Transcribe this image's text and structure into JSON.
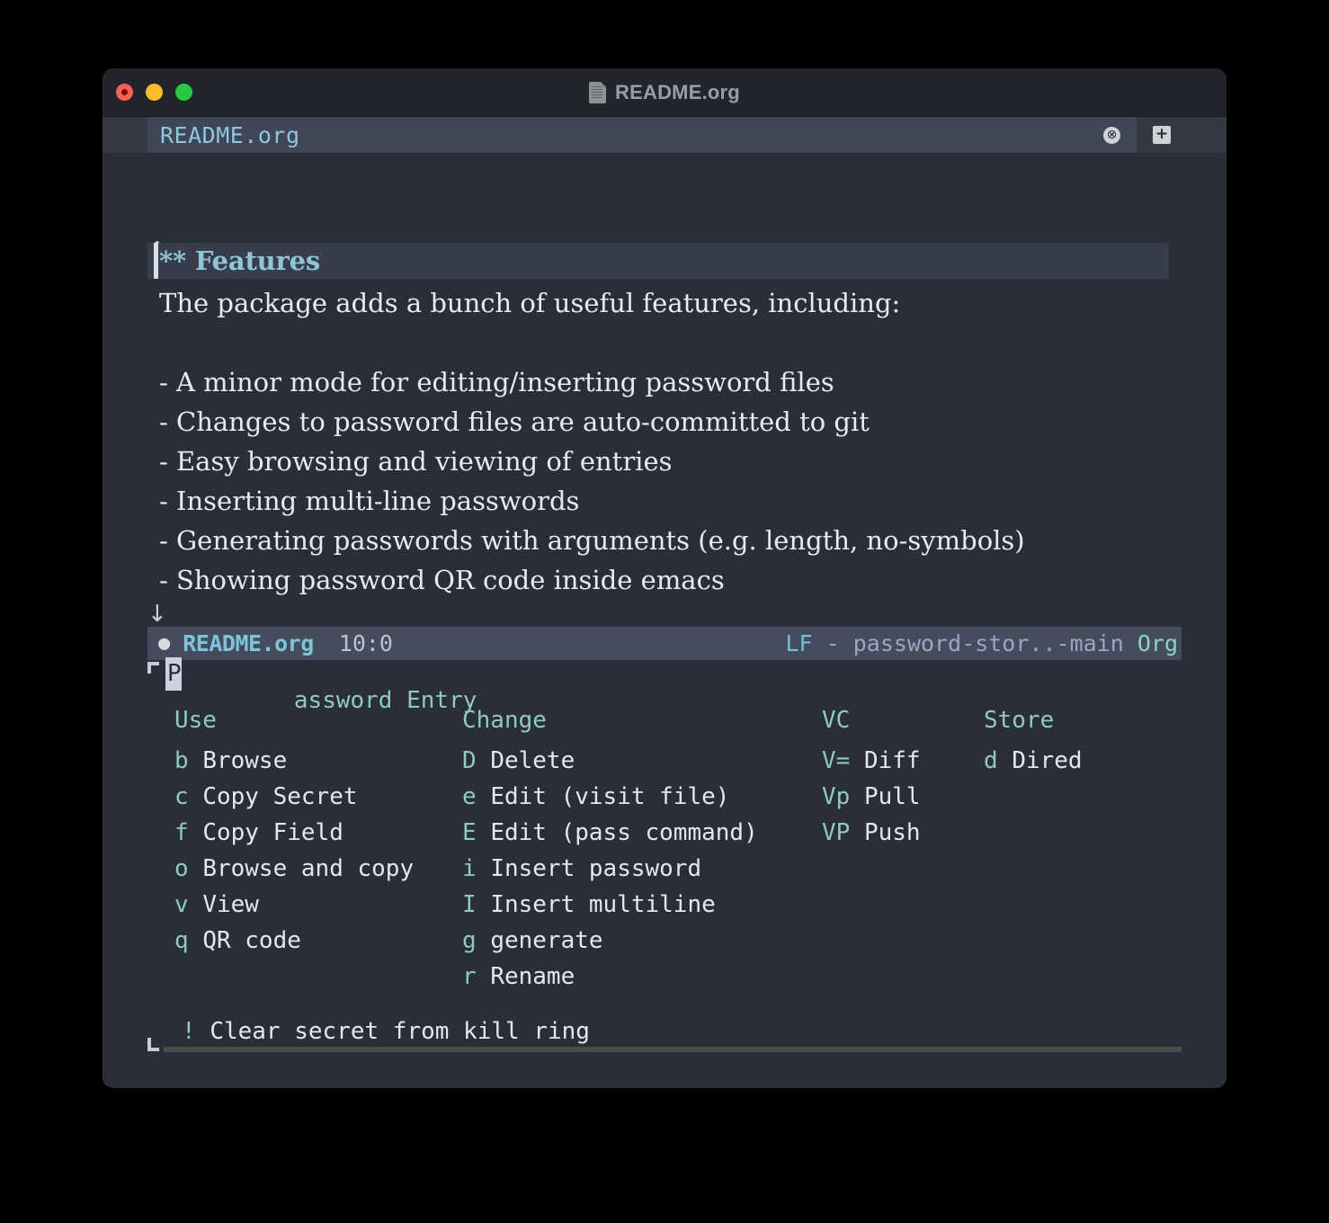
{
  "window": {
    "title": "README.org",
    "title_icon": "document-icon",
    "controls": {
      "close": "close-button",
      "minimize": "minimize-button",
      "maximize": "maximize-button"
    }
  },
  "tabbar": {
    "active_tab": "README.org",
    "close_glyph": "⊗",
    "new_tab_glyph": "+"
  },
  "buffer": {
    "heading": "** Features",
    "paragraph": "The package adds a bunch of useful features, including:",
    "features": [
      "- A minor mode for editing/inserting password files",
      "- Changes to password files are auto-committed to git",
      "- Easy browsing and viewing of entries",
      "- Inserting multi-line passwords",
      "- Generating passwords with arguments (e.g. length, no-symbols)",
      "- Showing password QR code inside emacs"
    ],
    "fringe_top_arrow": "↑",
    "fringe_bottom_arrow": "↓"
  },
  "modeline": {
    "modified_dot": "●",
    "buffer_name": "README.org",
    "position": "10:0",
    "eol": "LF",
    "vc": "- password-stor..-main",
    "major_mode": "Org"
  },
  "transient": {
    "title": "Password Entry",
    "title_first_char": "P",
    "title_rest": "assword Entry",
    "columns": [
      {
        "header": "Use",
        "items": [
          {
            "key": "b",
            "desc": "Browse"
          },
          {
            "key": "c",
            "desc": "Copy Secret"
          },
          {
            "key": "f",
            "desc": "Copy Field"
          },
          {
            "key": "o",
            "desc": "Browse and copy"
          },
          {
            "key": "v",
            "desc": "View"
          },
          {
            "key": "q",
            "desc": "QR code"
          }
        ]
      },
      {
        "header": "Change",
        "items": [
          {
            "key": "D",
            "desc": "Delete"
          },
          {
            "key": "e",
            "desc": "Edit (visit file)"
          },
          {
            "key": "E",
            "desc": "Edit (pass command)"
          },
          {
            "key": "i",
            "desc": "Insert password"
          },
          {
            "key": "I",
            "desc": "Insert multiline"
          },
          {
            "key": "g",
            "desc": "generate"
          },
          {
            "key": "r",
            "desc": "Rename"
          }
        ]
      },
      {
        "header": "VC",
        "items": [
          {
            "key": "V=",
            "desc": "Diff"
          },
          {
            "key": "Vp",
            "desc": "Pull"
          },
          {
            "key": "VP",
            "desc": "Push"
          }
        ]
      },
      {
        "header": "Store",
        "items": [
          {
            "key": "d",
            "desc": "Dired"
          }
        ]
      }
    ],
    "footer": {
      "key": "!",
      "desc": "Clear secret from kill ring"
    }
  },
  "colors": {
    "background": "#2a2e39",
    "titlebar": "#22252b",
    "tabbar": "#343945",
    "tab_active": "#3f4756",
    "modeline": "#454c5e",
    "heading_band": "#373d4b",
    "accent_teal": "#8fc9c0",
    "accent_blue": "#8ec6e0",
    "text": "#e8eaef"
  }
}
